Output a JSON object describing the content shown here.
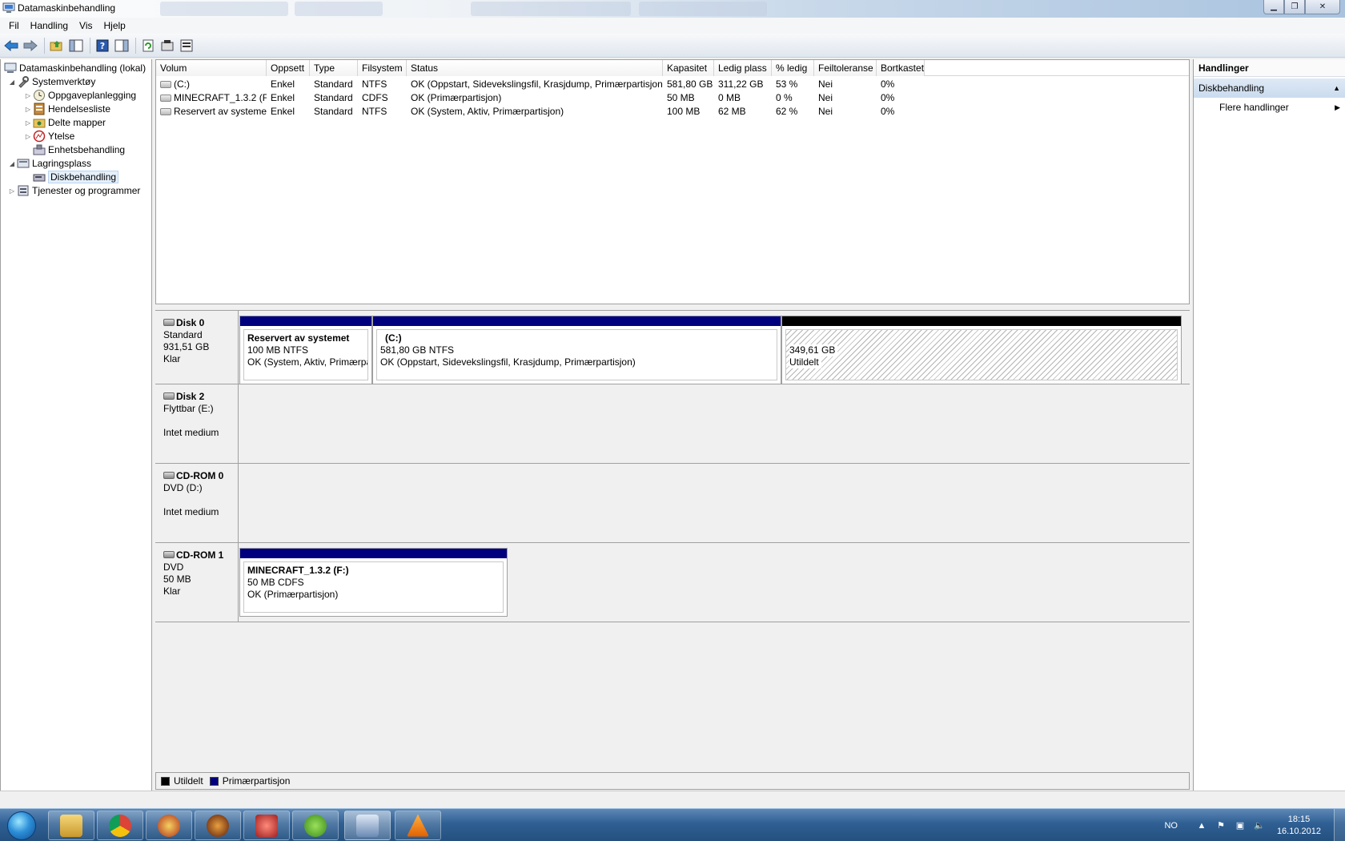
{
  "window": {
    "title": "Datamaskinbehandling"
  },
  "menu": [
    "Fil",
    "Handling",
    "Vis",
    "Hjelp"
  ],
  "tree": {
    "root": "Datamaskinbehandling (lokal)",
    "systemverktoy": "Systemverktøy",
    "oppgave": "Oppgaveplanlegging",
    "hendelse": "Hendelsesliste",
    "delte": "Delte mapper",
    "ytelse": "Ytelse",
    "enhet": "Enhetsbehandling",
    "lagring": "Lagringsplass",
    "disk": "Diskbehandling",
    "tjenester": "Tjenester og programmer"
  },
  "volumes": {
    "columns": [
      "Volum",
      "Oppsett",
      "Type",
      "Filsystem",
      "Status",
      "Kapasitet",
      "Ledig plass",
      "% ledig",
      "Feiltoleranse",
      "Bortkastet"
    ],
    "rows": [
      [
        "(C:)",
        "Enkel",
        "Standard",
        "NTFS",
        "OK (Oppstart, Sidevekslingsfil, Krasjdump, Primærpartisjon)",
        "581,80 GB",
        "311,22 GB",
        "53 %",
        "Nei",
        "0%"
      ],
      [
        "MINECRAFT_1.3.2 (F:)",
        "Enkel",
        "Standard",
        "CDFS",
        "OK (Primærpartisjon)",
        "50 MB",
        "0 MB",
        "0 %",
        "Nei",
        "0%"
      ],
      [
        "Reservert av systemet",
        "Enkel",
        "Standard",
        "NTFS",
        "OK (System, Aktiv, Primærpartisjon)",
        "100 MB",
        "62 MB",
        "62 %",
        "Nei",
        "0%"
      ]
    ]
  },
  "disks": {
    "disk0": {
      "name": "Disk 0",
      "type": "Standard",
      "size": "931,51 GB",
      "state": "Klar",
      "p1": {
        "title": "Reservert av systemet",
        "size": "100 MB NTFS",
        "status": "OK (System, Aktiv, Primærpart"
      },
      "p2": {
        "title": "(C:)",
        "size": "581,80 GB NTFS",
        "status": "OK (Oppstart, Sidevekslingsfil, Krasjdump, Primærpartisjon)"
      },
      "p3": {
        "size": "349,61 GB",
        "status": "Utildelt"
      }
    },
    "disk2": {
      "name": "Disk 2",
      "type": "Flyttbar (E:)",
      "state": "Intet medium"
    },
    "cdrom0": {
      "name": "CD-ROM 0",
      "type": "DVD (D:)",
      "state": "Intet medium"
    },
    "cdrom1": {
      "name": "CD-ROM 1",
      "type": "DVD",
      "size": "50 MB",
      "state": "Klar",
      "p1": {
        "title": "MINECRAFT_1.3.2  (F:)",
        "size": "50 MB CDFS",
        "status": "OK (Primærpartisjon)"
      }
    }
  },
  "legend": {
    "unallocated": "Utildelt",
    "primary": "Primærpartisjon"
  },
  "actions": {
    "header": "Handlinger",
    "section": "Diskbehandling",
    "more": "Flere handlinger"
  },
  "tray": {
    "lang": "NO",
    "time": "18:15",
    "date": "16.10.2012"
  },
  "colors": {
    "primary": "#00007f",
    "unallocated": "#000000",
    "taskbar": "#2f5f93"
  }
}
